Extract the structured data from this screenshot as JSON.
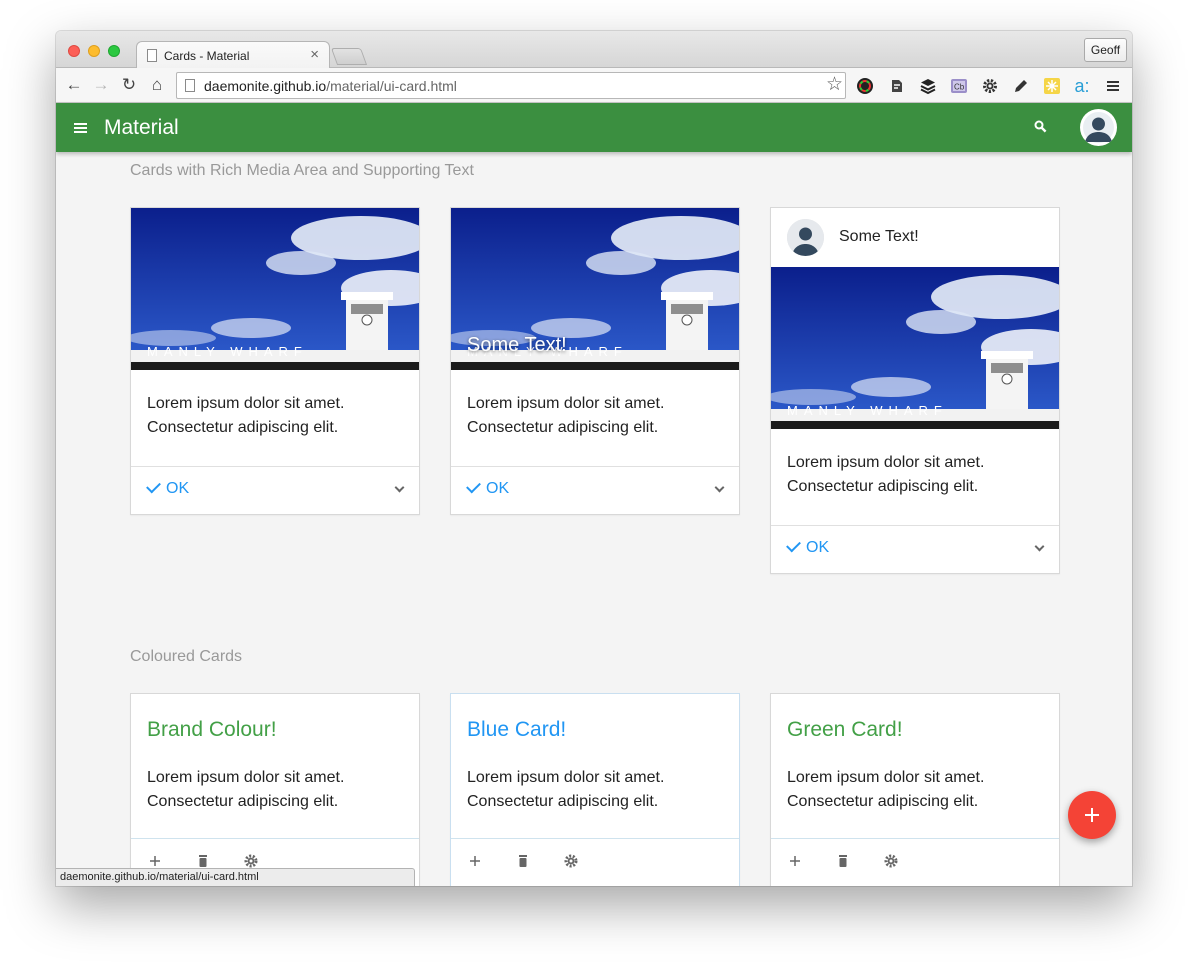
{
  "browser": {
    "tab_title": "Cards - Material",
    "url_host": "daemonite.github.io",
    "url_path": "/material/ui-card.html",
    "profile_name": "Geoff",
    "status_url": "daemonite.github.io/material/ui-card.html"
  },
  "appbar": {
    "title": "Material",
    "color": "#3b8f40"
  },
  "sections": {
    "rich_media_title": "Cards with Rich Media Area and Supporting Text",
    "coloured_title": "Coloured Cards"
  },
  "media_cards": [
    {
      "text_line1": "Lorem ipsum dolor sit amet.",
      "text_line2": "Consectetur adipiscing elit.",
      "action_label": "OK"
    },
    {
      "caption": "Some Text!",
      "text_line1": "Lorem ipsum dolor sit amet.",
      "text_line2": "Consectetur adipiscing elit.",
      "action_label": "OK"
    },
    {
      "header_text": "Some Text!",
      "text_line1": "Lorem ipsum dolor sit amet.",
      "text_line2": "Consectetur adipiscing elit.",
      "action_label": "OK"
    }
  ],
  "colour_cards": [
    {
      "title": "Brand Colour!",
      "title_color": "#43a047",
      "text_line1": "Lorem ipsum dolor sit amet.",
      "text_line2": "Consectetur adipiscing elit."
    },
    {
      "title": "Blue Card!",
      "title_color": "#2196f3",
      "text_line1": "Lorem ipsum dolor sit amet.",
      "text_line2": "Consectetur adipiscing elit."
    },
    {
      "title": "Green Card!",
      "title_color": "#43a047",
      "text_line1": "Lorem ipsum dolor sit amet.",
      "text_line2": "Consectetur adipiscing elit."
    }
  ],
  "media_image": {
    "sign_text": "MANLY WHARF"
  },
  "colors": {
    "link_blue": "#2196f3",
    "fab_red": "#f44336"
  }
}
